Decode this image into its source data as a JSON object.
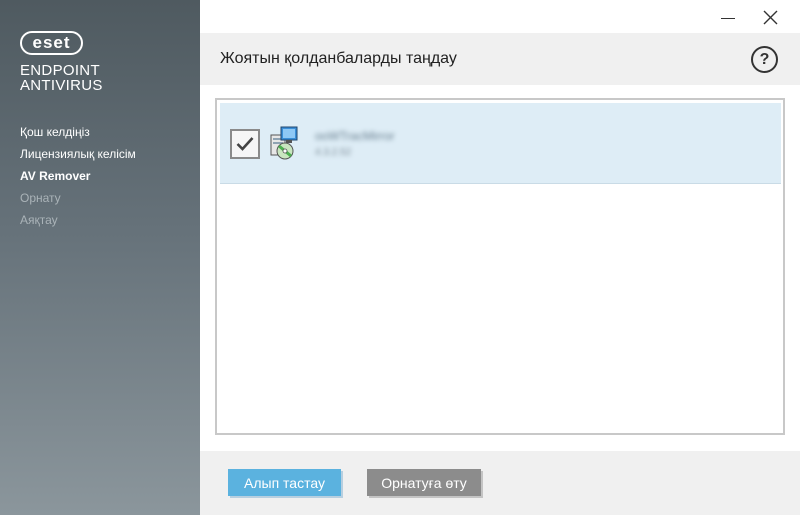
{
  "sidebar": {
    "logo": "eset",
    "product_line1": "ENDPOINT",
    "product_line2": "ANTIVIRUS",
    "steps": [
      {
        "label": "Қош келдіңіз",
        "state": "done"
      },
      {
        "label": "Лицензиялық келісім",
        "state": "done"
      },
      {
        "label": "AV Remover",
        "state": "current"
      },
      {
        "label": "Орнату",
        "state": "future"
      },
      {
        "label": "Аяқтау",
        "state": "future"
      }
    ]
  },
  "window": {
    "minimize_icon": "minimize-icon",
    "close_icon": "close-icon"
  },
  "header": {
    "title": "Жоятын қолданбаларды таңдау",
    "help_label": "?"
  },
  "applications": [
    {
      "name": "ooWTracMirror",
      "version": "4.3.2.52",
      "checked": true,
      "icon": "installer-package-icon"
    }
  ],
  "footer": {
    "remove_label": "Алып тастау",
    "next_label": "Орнатуға өту"
  },
  "colors": {
    "accent": "#5bb2df",
    "secondary_button": "#8c8c8c",
    "selected_row": "#deedf6"
  }
}
